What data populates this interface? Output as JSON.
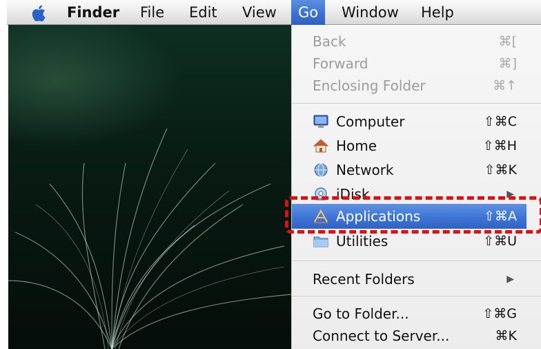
{
  "menubar": {
    "items": [
      {
        "label": "Finder"
      },
      {
        "label": "File"
      },
      {
        "label": "Edit"
      },
      {
        "label": "View"
      },
      {
        "label": "Go"
      },
      {
        "label": "Window"
      },
      {
        "label": "Help"
      }
    ],
    "active_menu": "Go"
  },
  "go_menu": {
    "group1": [
      {
        "label": "Back",
        "shortcut": "⌘[",
        "enabled": false
      },
      {
        "label": "Forward",
        "shortcut": "⌘]",
        "enabled": false
      },
      {
        "label": "Enclosing Folder",
        "shortcut": "⌘↑",
        "enabled": false
      }
    ],
    "group2": [
      {
        "label": "Computer",
        "shortcut": "⇧⌘C",
        "icon": "computer-icon"
      },
      {
        "label": "Home",
        "shortcut": "⇧⌘H",
        "icon": "home-icon"
      },
      {
        "label": "Network",
        "shortcut": "⇧⌘K",
        "icon": "network-icon"
      },
      {
        "label": "iDisk",
        "shortcut": "▶",
        "icon": "idisk-icon",
        "submenu": true
      },
      {
        "label": "Applications",
        "shortcut": "⇧⌘A",
        "icon": "applications-icon",
        "highlighted": true
      },
      {
        "label": "Utilities",
        "shortcut": "⇧⌘U",
        "icon": "utilities-folder-icon"
      }
    ],
    "group3": [
      {
        "label": "Recent Folders",
        "shortcut": "▶",
        "submenu": true
      }
    ],
    "group4": [
      {
        "label": "Go to Folder...",
        "shortcut": "⇧⌘G"
      },
      {
        "label": "Connect to Server...",
        "shortcut": "⌘K"
      }
    ]
  },
  "colors": {
    "highlight": "#3e74d6",
    "callout": "#e01010",
    "disabled_text": "#9b9b9b"
  }
}
